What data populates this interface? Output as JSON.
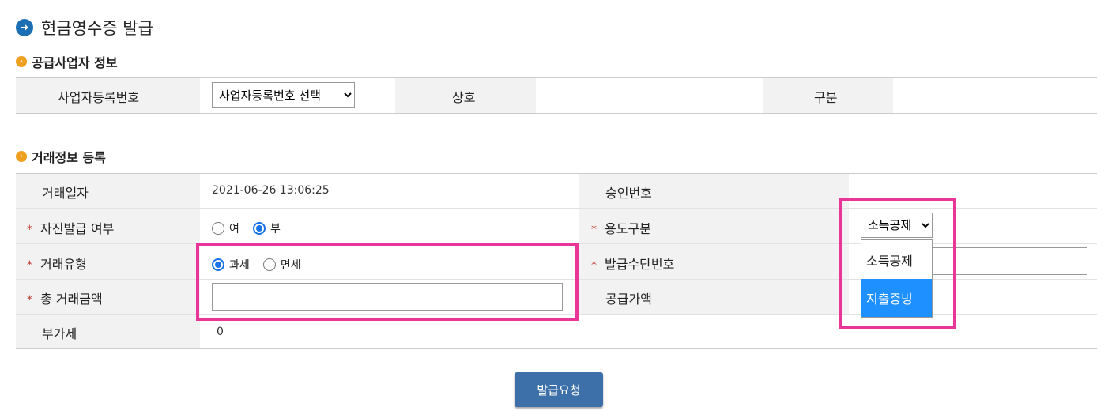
{
  "page": {
    "title": "현금영수증 발급"
  },
  "supplier": {
    "section_title": "공급사업자 정보",
    "reg_no_label": "사업자등록번호",
    "reg_no_select": "사업자등록번호 선택",
    "company_label": "상호",
    "company_value": "",
    "category_label": "구분",
    "category_value": ""
  },
  "transaction": {
    "section_title": "거래정보 등록",
    "date_label": "거래일자",
    "date_value": "2021-06-26 13:06:25",
    "approval_label": "승인번호",
    "self_issue_label": "자진발급 여부",
    "self_issue_options": [
      "여",
      "부"
    ],
    "self_issue_selected": "부",
    "purpose_label": "용도구분",
    "purpose_selected": "소득공제",
    "purpose_options": [
      "소득공제",
      "지출증빙"
    ],
    "purpose_highlighted": "지출증빙",
    "type_label": "거래유형",
    "type_options": [
      "과세",
      "면세"
    ],
    "type_selected": "과세",
    "issue_no_label": "발급수단번호",
    "total_label": "총 거래금액",
    "total_value": "",
    "supply_label": "공급가액",
    "vat_label": "부가세",
    "vat_value": "0"
  },
  "submit": {
    "label": "발급요청"
  },
  "colors": {
    "highlight_box": "#e8359a",
    "button": "#3d6fa8",
    "required_mark": "#c0392b"
  }
}
